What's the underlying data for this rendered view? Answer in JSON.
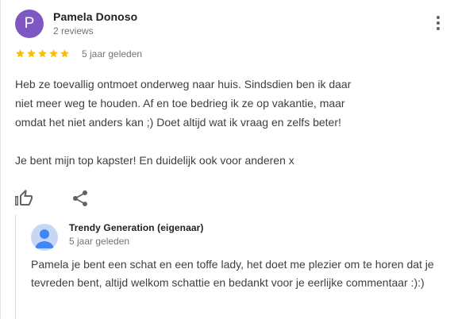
{
  "review": {
    "author_initial": "P",
    "author_name": "Pamela Donoso",
    "author_reviews": "2 reviews",
    "rating": 5,
    "rating_max": 5,
    "date": "5 jaar geleden",
    "paragraphs": [
      "Heb ze toevallig ontmoet onderweg naar huis. Sindsdien ben ik daar niet meer weg te houden. Af en toe bedrieg ik ze op vakantie, maar omdat het niet anders kan ;) Doet altijd wat ik vraag en zelfs beter!",
      "Je bent mijn top kapster! En duidelijk ook voor anderen x"
    ]
  },
  "owner_reply": {
    "author": "Trendy Generation (eigenaar)",
    "date": "5 jaar geleden",
    "text": "Pamela je bent een schat en een toffe lady, het doet me plezier om te horen dat je tevreden bent, altijd welkom schattie en bedankt voor je eerlijke commentaar :):)"
  },
  "icons": {
    "more": "more-vert-icon",
    "like": "thumb-up-icon",
    "share": "share-icon",
    "owner_avatar": "person-icon"
  },
  "colors": {
    "avatar_bg": "#7e57c2",
    "star": "#fbbc04",
    "owner_avatar_bg": "#c5d7f3",
    "owner_avatar_fg": "#4285f4"
  }
}
